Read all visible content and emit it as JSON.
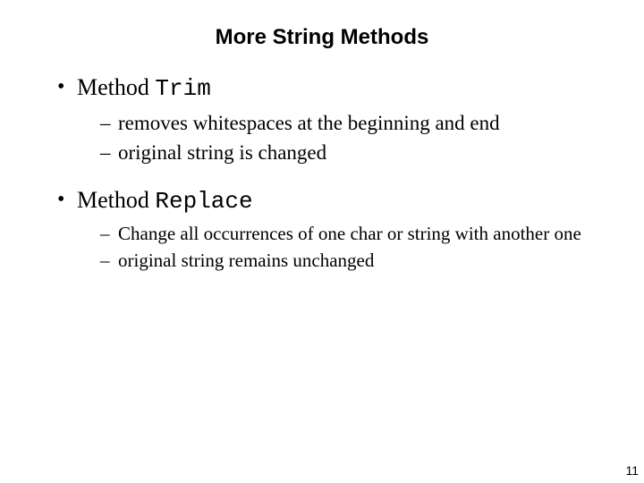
{
  "title": "More String Methods",
  "bullets": [
    {
      "prefix": "Method ",
      "method_name": "Trim",
      "sub": [
        "removes whitespaces at the beginning and end",
        "original string is changed"
      ],
      "sub_small": false
    },
    {
      "prefix": "Method ",
      "method_name": "Replace",
      "sub": [
        "Change all occurrences of one char or string with another one",
        "original string remains unchanged"
      ],
      "sub_small": true
    }
  ],
  "page_number": "11"
}
